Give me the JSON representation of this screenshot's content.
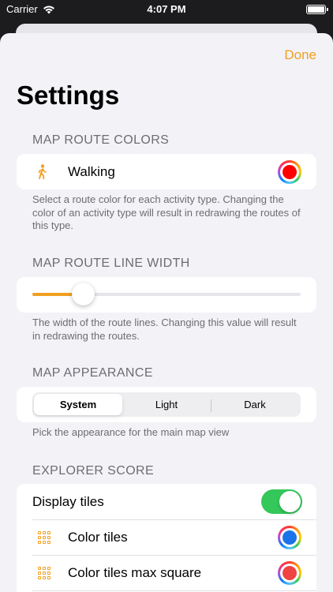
{
  "status_bar": {
    "carrier": "Carrier",
    "time": "4:07 PM"
  },
  "nav": {
    "done_label": "Done",
    "title": "Settings"
  },
  "map_route_colors": {
    "header": "MAP ROUTE COLORS",
    "row_label": "Walking",
    "row_icon": "walking-figure-icon",
    "color": "#ff0000",
    "footer": "Select a route color for each activity type. Changing the color of an activity type will result in redrawing the routes of this type."
  },
  "map_route_line_width": {
    "header": "MAP ROUTE LINE WIDTH",
    "value_fraction": 0.19,
    "accent": "#f0a020",
    "footer": "The width of the route lines. Changing this value will result in redrawing the routes."
  },
  "map_appearance": {
    "header": "MAP APPEARANCE",
    "options": [
      "System",
      "Light",
      "Dark"
    ],
    "selected": "System",
    "footer": "Pick the appearance for the main map view"
  },
  "explorer_score": {
    "header": "EXPLORER SCORE",
    "display_tiles_label": "Display tiles",
    "display_tiles_on": true,
    "color_tiles_label": "Color tiles",
    "color_tiles_color": "#1a73e8",
    "color_tiles_icon": "grid-icon",
    "max_square_label": "Color tiles max square",
    "max_square_color": "#ef4444",
    "max_square_icon": "grid-icon"
  }
}
